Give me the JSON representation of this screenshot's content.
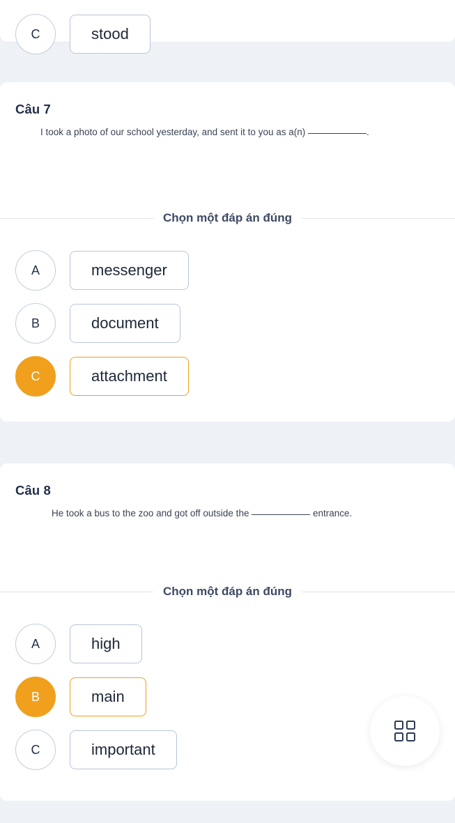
{
  "previous_question": {
    "visible_option": {
      "letter": "C",
      "label": "stood",
      "selected": false
    }
  },
  "chooser_label": "Chọn một đáp án đúng",
  "colors": {
    "accent_orange": "#f0a01c",
    "text_navy": "#22304a",
    "page_background": "#eef1f6",
    "card_background": "#ffffff",
    "option_border": "#b9c5d8",
    "divider": "#e4e3ee"
  },
  "questions": [
    {
      "title": "Câu 7",
      "text_before": "I took a photo of our school yesterday, and sent it to you as a(n)",
      "text_after": ".",
      "options": [
        {
          "letter": "A",
          "label": "messenger",
          "selected": false
        },
        {
          "letter": "B",
          "label": "document",
          "selected": false
        },
        {
          "letter": "C",
          "label": "attachment",
          "selected": true
        }
      ]
    },
    {
      "title": "Câu 8",
      "text_before": "He took a bus to the zoo and got off outside the",
      "text_after": "entrance.",
      "options": [
        {
          "letter": "A",
          "label": "high",
          "selected": false
        },
        {
          "letter": "B",
          "label": "main",
          "selected": true
        },
        {
          "letter": "C",
          "label": "important",
          "selected": false
        }
      ]
    }
  ],
  "palette_button": {
    "icon": "grid-icon"
  }
}
